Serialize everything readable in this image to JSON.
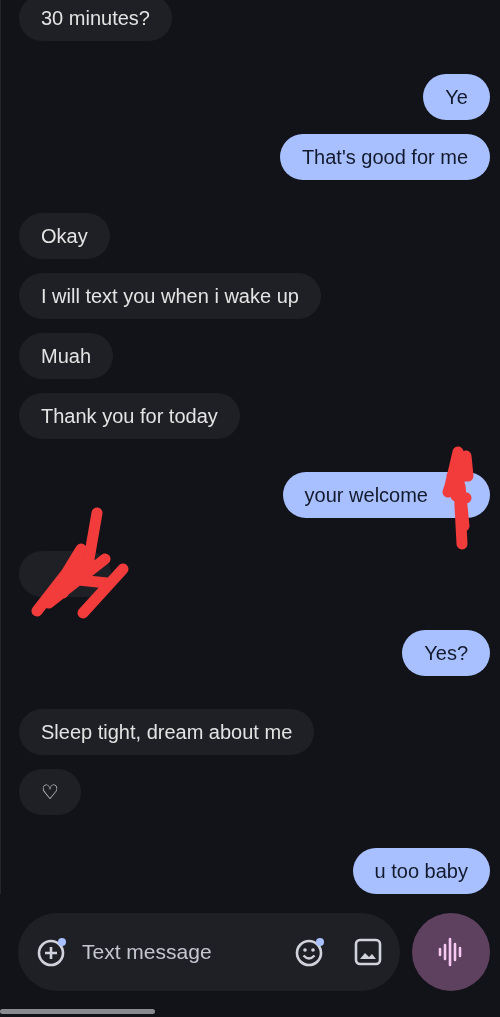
{
  "messages": [
    {
      "text": "30 minutes?",
      "outgoing": false,
      "kind": "text",
      "scribbled": false
    },
    {
      "text": "Ye",
      "outgoing": true,
      "kind": "text",
      "scribbled": false
    },
    {
      "text": "That's good for me",
      "outgoing": true,
      "kind": "text",
      "scribbled": false
    },
    {
      "text": "Okay",
      "outgoing": false,
      "kind": "text",
      "scribbled": false
    },
    {
      "text": "I will text you when i wake up",
      "outgoing": false,
      "kind": "text",
      "scribbled": false
    },
    {
      "text": "Muah",
      "outgoing": false,
      "kind": "text",
      "scribbled": false
    },
    {
      "text": "Thank you for today",
      "outgoing": false,
      "kind": "text",
      "scribbled": false
    },
    {
      "text": "your welcome",
      "outgoing": true,
      "kind": "text",
      "scribbled": true
    },
    {
      "outgoing": false,
      "kind": "redacted",
      "scribbled": true
    },
    {
      "text": "Yes?",
      "outgoing": true,
      "kind": "text",
      "scribbled": false
    },
    {
      "text": "Sleep tight, dream about me",
      "outgoing": false,
      "kind": "text",
      "scribbled": false
    },
    {
      "text": "♡",
      "outgoing": false,
      "kind": "text",
      "scribbled": false
    },
    {
      "text": "u too baby",
      "outgoing": true,
      "kind": "text",
      "scribbled": false
    }
  ],
  "composer": {
    "placeholder": "Text message"
  }
}
